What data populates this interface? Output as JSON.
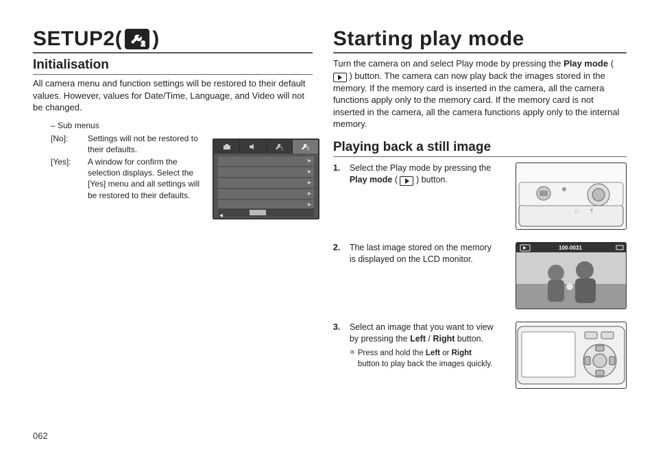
{
  "page_number": "062",
  "left": {
    "heading": "SETUP2(",
    "heading_tail": ")",
    "icon_name": "wrench-2-icon",
    "section": "Initialisation",
    "intro": "All camera menu and function settings will be restored to their default values. However, values for Date/Time, Language, and Video will not be changed.",
    "sub_label": "– Sub menus",
    "options": [
      {
        "key": "[No]:",
        "val": "Settings will not be restored to their defaults."
      },
      {
        "key": "[Yes]:",
        "val": "A window for confirm the selection displays. Select the [Yes] menu and all settings will be restored to their defaults."
      }
    ],
    "lcd_tabs": [
      "camera",
      "sound",
      "wrench1",
      "wrench2"
    ]
  },
  "right": {
    "heading": "Starting play mode",
    "intro_a": "Turn the camera on and select Play mode by pressing the ",
    "intro_b_bold": "Play mode",
    "intro_c": " (",
    "intro_d": ") button. The camera can now play back the images stored in the memory. If the memory card is inserted in the camera, all the camera functions apply only to the memory card. If the memory card is not inserted in the camera, all the camera functions apply only to the internal memory.",
    "section": "Playing back a still image",
    "steps": [
      {
        "n": "1.",
        "pre": "Select the Play mode by pressing the ",
        "bold": "Play mode",
        "mid": " (",
        "post": ") button."
      },
      {
        "n": "2.",
        "text": "The last image stored on the memory is displayed on the LCD monitor.",
        "photo_label": "100-0031"
      },
      {
        "n": "3.",
        "pre": "Select an image that you want to view by pressing the ",
        "bold1": "Left",
        "slash": "/",
        "bold2": "Right",
        "post": " button.",
        "note_pre": "Press and hold the ",
        "note_b1": "Left",
        "note_or": " or ",
        "note_b2": "Right",
        "note_post": " button to play back the images quickly."
      }
    ]
  }
}
